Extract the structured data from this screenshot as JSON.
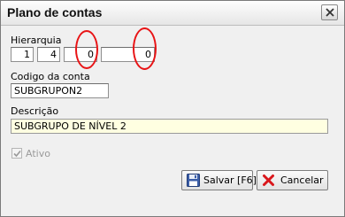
{
  "window": {
    "title": "Plano de contas",
    "close_icon": "close-x-icon"
  },
  "form": {
    "hierarquia_label": "Hierarquia",
    "hierarquia_values": [
      "1",
      "4",
      "0",
      "0"
    ],
    "codigo_label": "Codigo da conta",
    "codigo_value": "SUBGRUPON2",
    "descricao_label": "Descrição",
    "descricao_value": "SUBGRUPO DE NÍVEL 2",
    "ativo_label": "Ativo",
    "ativo_checked": true
  },
  "buttons": {
    "save_label": "Salvar [F6]",
    "save_icon": "floppy-disk-icon",
    "cancel_label": "Cancelar",
    "cancel_icon": "red-x-icon"
  },
  "colors": {
    "annotation": "#e81416",
    "description_bg": "#ffffe1"
  }
}
